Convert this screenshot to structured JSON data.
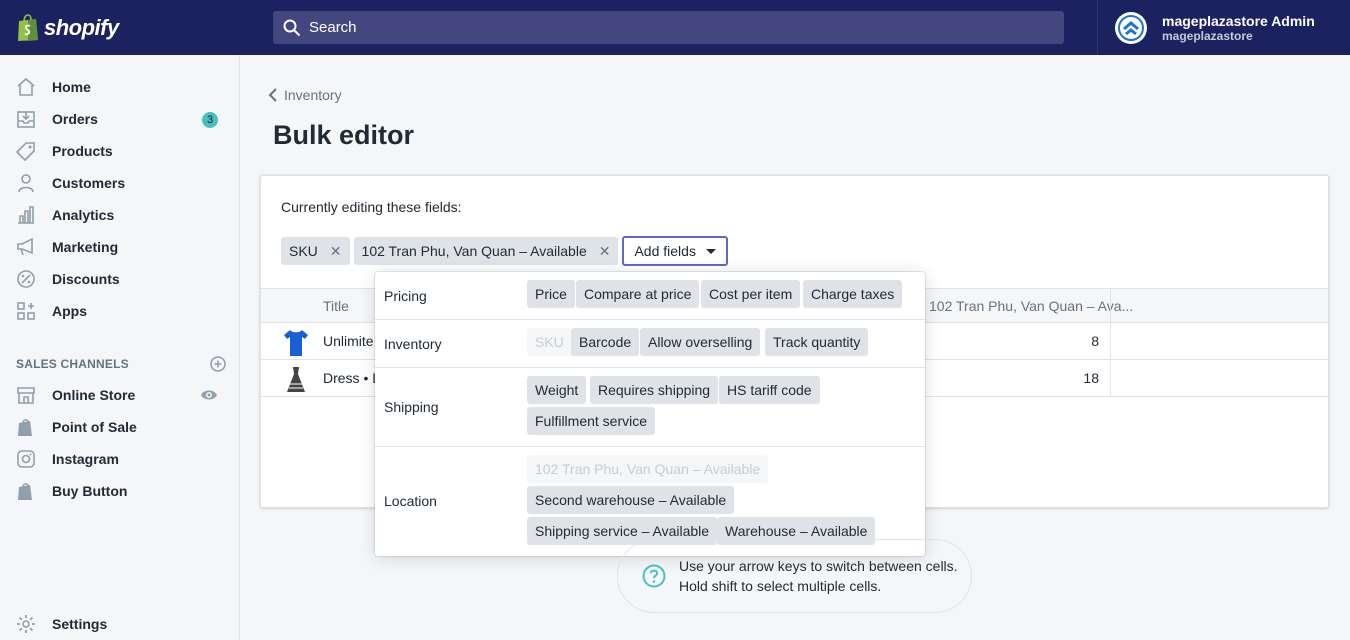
{
  "topbar": {
    "brand": "shopify",
    "search_placeholder": "Search",
    "account_name": "mageplazastore Admin",
    "account_store": "mageplazastore"
  },
  "sidebar": {
    "items": [
      {
        "label": "Home",
        "icon": "home-icon"
      },
      {
        "label": "Orders",
        "icon": "orders-icon",
        "badge": "3"
      },
      {
        "label": "Products",
        "icon": "tag-icon"
      },
      {
        "label": "Customers",
        "icon": "person-icon"
      },
      {
        "label": "Analytics",
        "icon": "analytics-icon"
      },
      {
        "label": "Marketing",
        "icon": "megaphone-icon"
      },
      {
        "label": "Discounts",
        "icon": "discount-icon"
      },
      {
        "label": "Apps",
        "icon": "apps-icon"
      }
    ],
    "channels_heading": "SALES CHANNELS",
    "channels": [
      {
        "label": "Online Store",
        "icon": "store-icon"
      },
      {
        "label": "Point of Sale",
        "icon": "bag-icon"
      },
      {
        "label": "Instagram",
        "icon": "instagram-icon"
      },
      {
        "label": "Buy Button",
        "icon": "bag-icon"
      }
    ],
    "settings": "Settings"
  },
  "main": {
    "breadcrumb": "Inventory",
    "title": "Bulk editor",
    "editing_label": "Currently editing these fields:",
    "chips": [
      "SKU",
      "102 Tran Phu, Van Quan – Available"
    ],
    "add_fields": "Add fields",
    "table": {
      "col_title": "Title",
      "col_location": "102 Tran Phu, Van Quan – Ava...",
      "rows": [
        {
          "name": "Unlimite",
          "qty": "8"
        },
        {
          "name": "Dress • D",
          "qty": "18"
        }
      ]
    }
  },
  "popover": {
    "sections": [
      {
        "label": "Pricing",
        "fields": [
          "Price",
          "Compare at price",
          "Cost per item",
          "Charge taxes"
        ]
      },
      {
        "label": "Inventory",
        "fields": [
          "SKU",
          "Barcode",
          "Allow overselling",
          "Track quantity"
        ]
      },
      {
        "label": "Shipping",
        "fields": [
          "Weight",
          "Requires shipping",
          "HS tariff code",
          "Fulfillment service"
        ]
      },
      {
        "label": "Location",
        "fields": [
          "102 Tran Phu, Van Quan – Available",
          "Second warehouse – Available",
          "Shipping service – Available",
          "Warehouse – Available"
        ]
      }
    ]
  },
  "help": {
    "line1": "Use your arrow keys to switch between cells.",
    "line2": "Hold shift to select multiple cells."
  },
  "colors": {
    "topbar": "#1c2260",
    "accent": "#5c6ac4",
    "badge": "#47c1bf",
    "help_icon": "#47c1bf"
  }
}
